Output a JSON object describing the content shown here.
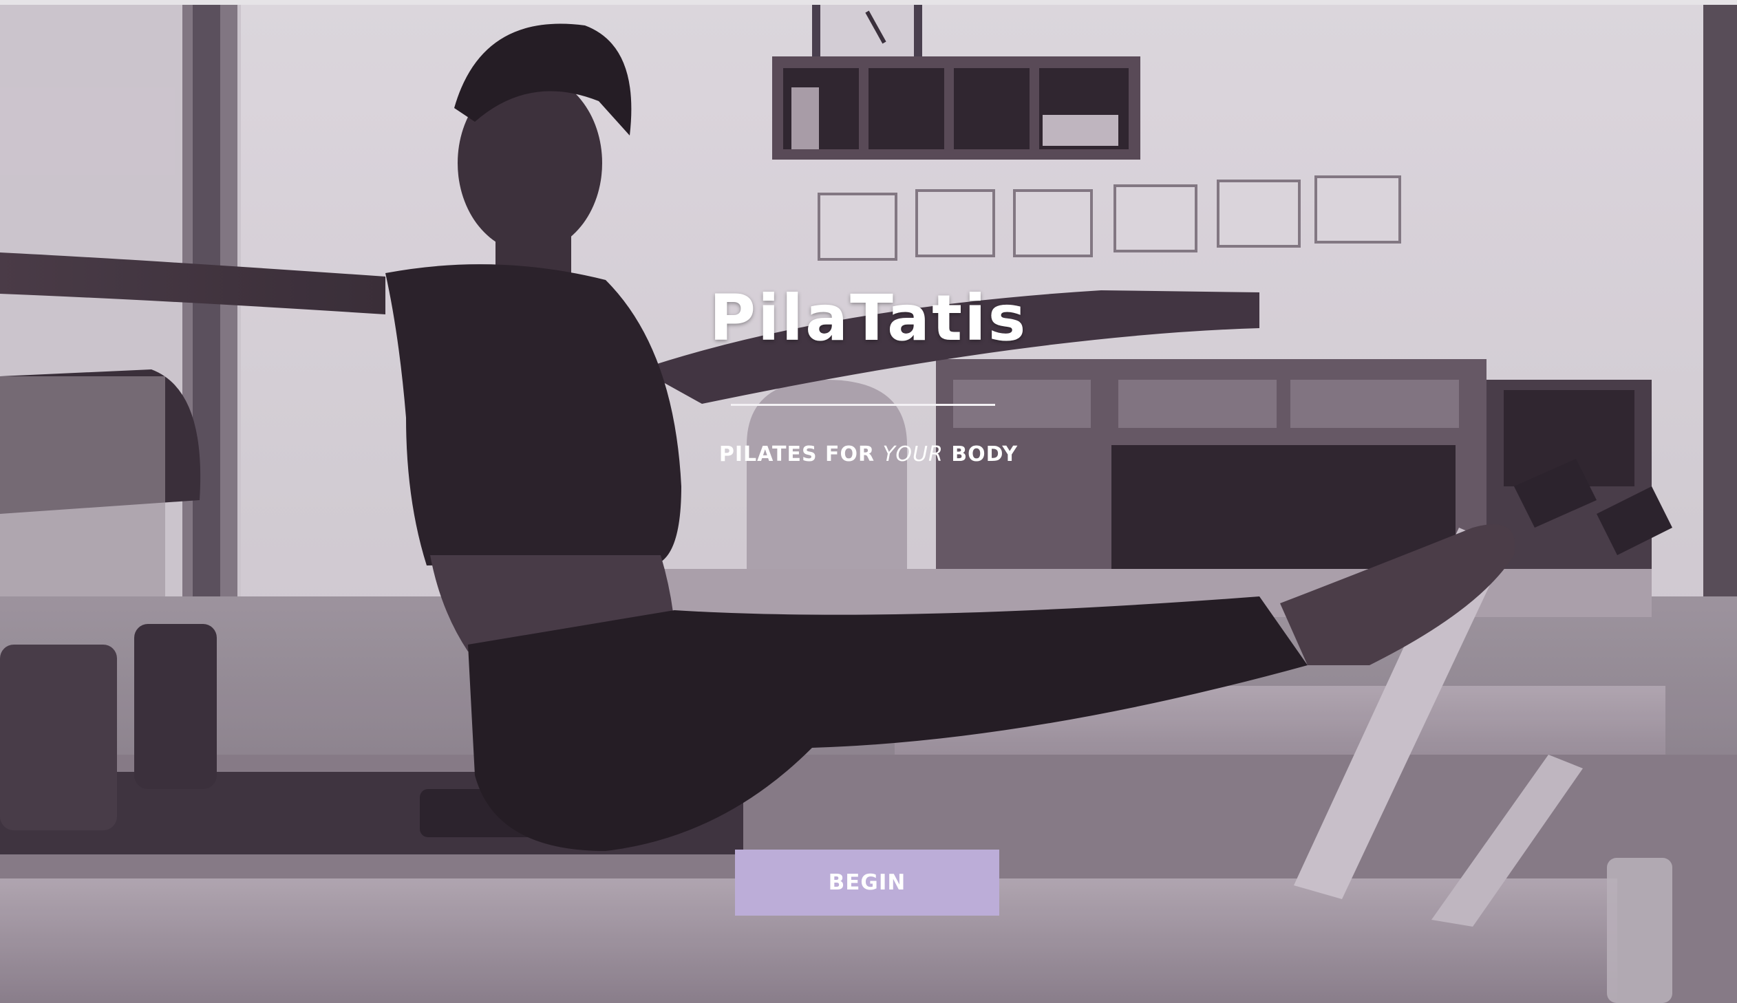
{
  "hero": {
    "brand_title": "PilaTatis",
    "tagline_before": "PILATES FOR",
    "tagline_emphasis": "YOUR",
    "tagline_after": "BODY",
    "button_label": "BEGIN",
    "image_description_icon": "pilates-studio-photo"
  },
  "colors": {
    "button_bg": "#bcadd8",
    "text": "#ffffff",
    "overlay_tint": "#3c2846"
  }
}
